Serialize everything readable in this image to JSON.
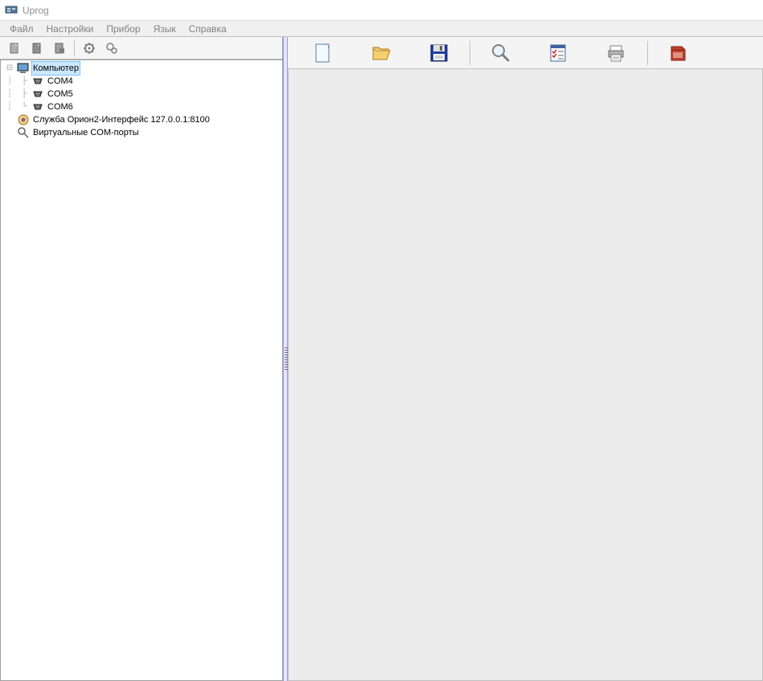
{
  "window": {
    "title": "Uprog"
  },
  "menu": {
    "items": [
      "Файл",
      "Настройки",
      "Прибор",
      "Язык",
      "Справка"
    ]
  },
  "left_toolbar": {
    "icons": [
      "tool1",
      "tool2",
      "tool3",
      "gear1",
      "gear2"
    ]
  },
  "tree": {
    "computer_label": "Компьютер",
    "com_ports": [
      "COM4",
      "COM5",
      "COM6"
    ],
    "service_label": "Служба Орион2-Интерфейс 127.0.0.1:8100",
    "virtual_label": "Виртуальные COM-порты"
  },
  "right_toolbar": {
    "icons": [
      "new-file",
      "open-folder",
      "save",
      "search",
      "checklist",
      "print",
      "folder2"
    ]
  }
}
